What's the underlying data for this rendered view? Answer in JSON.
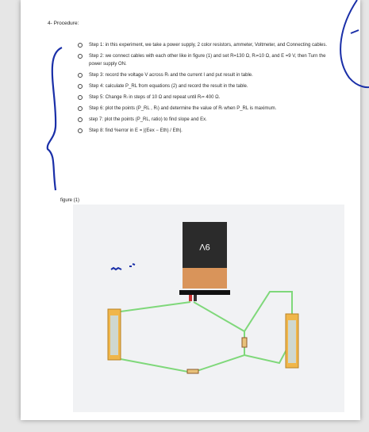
{
  "procedure": {
    "heading": "4- Procedure:",
    "steps": [
      "Step 1:  in this experiment, we take a power supply, 2 color resistors, ammeter, Voltmeter, and Connecting cables.",
      "Step 2: we connect cables with each other like in figure (1) and set R=130 Ω, Rₗ=10 Ω, and E =9 V, then Turn the power supply ON.",
      "Step 3: record the voltage V across Rₗ and the current I and put result in table.",
      "Step 4: calculate P_RL from equations (2) and record the result in the table.",
      "Step 5: Change Rₗ in steps of 10 Ω and repeat until Rₗ= 400 Ω.",
      "Step 6: plot the points (P_RL , Rₗ) and determine the value of Rₗ when P_RL is maximum.",
      "step 7: plot the points (P_RL, ratio) to find slope and Ex.",
      "Step 8: find %error in E = |(Eex − Eth) / Eth|."
    ]
  },
  "figure": {
    "label": "figure (1)",
    "battery_label": "9V"
  },
  "colors": {
    "page": "#ffffff",
    "wire": "#7fd87a",
    "battery_top": "#2b2b2b",
    "battery_bottom": "#d9945a",
    "meter": "#f0b64a",
    "annotation": "#1a2fa8"
  }
}
